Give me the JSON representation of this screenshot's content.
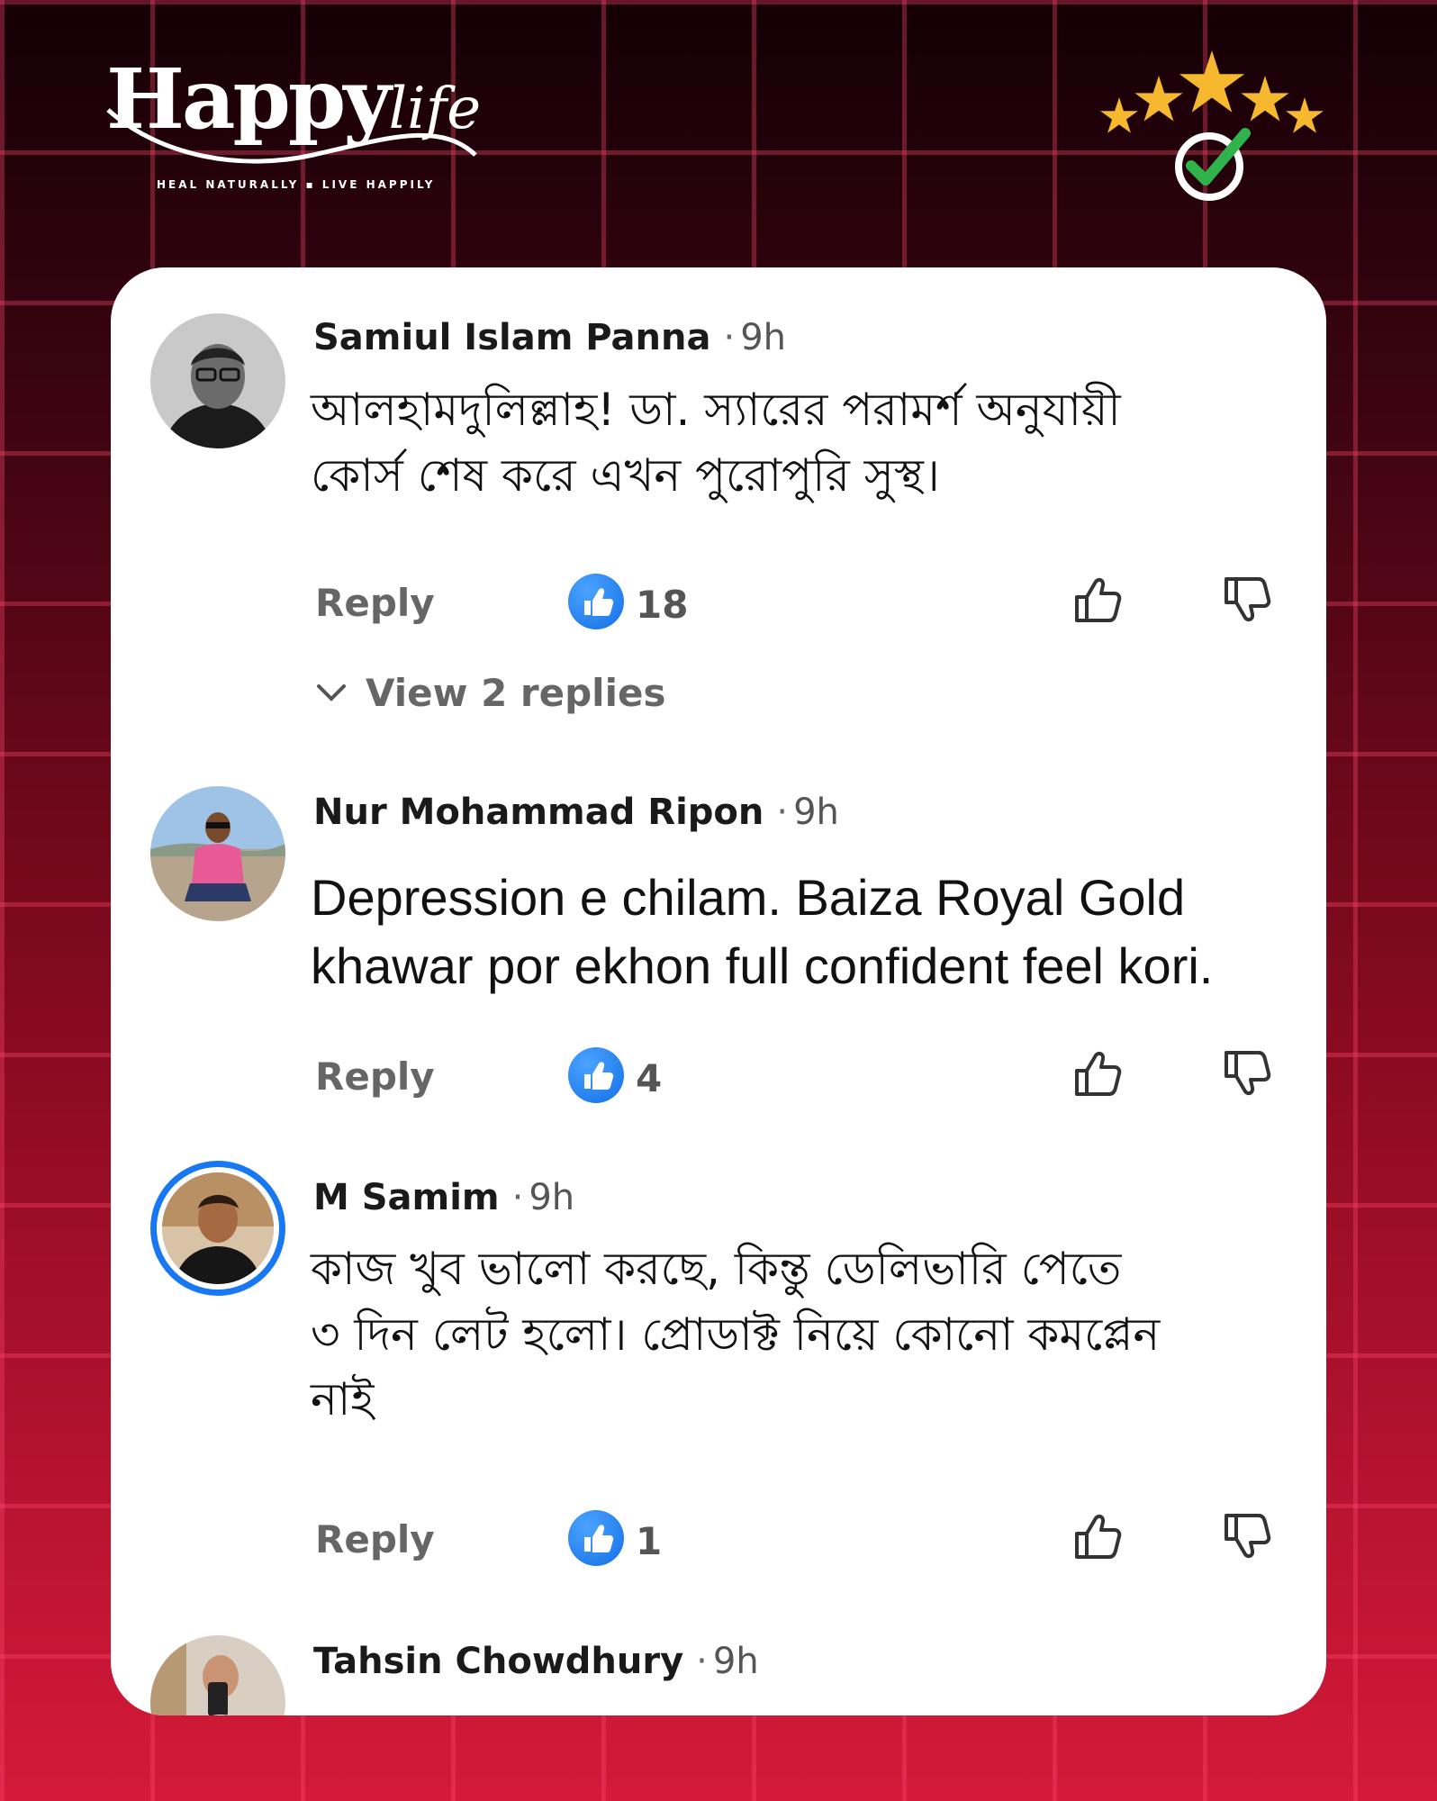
{
  "brand": {
    "logo_text_happy": "Happy",
    "logo_text_life": "life",
    "tagline": "HEAL NATURALLY ▪ LIVE HAPPILY",
    "badge_icon": "five-stars-check-icon"
  },
  "colors": {
    "like_blue": "#1877f2",
    "accent_red": "#d5193a",
    "check_green": "#2fb34a",
    "star_gold": "#f5b82e"
  },
  "comments": [
    {
      "name": "Samiul Islam Panna",
      "separator": "·",
      "time": "9h",
      "text_line1": "আলহামদুলিল্লাহ! ডা. স্যারের পরামর্শ অনুযায়ী",
      "text_line2": "কোর্স শেষ করে এখন পুরোপুরি সুস্থ।",
      "reply_label": "Reply",
      "likes": "18",
      "view_replies": "View 2 replies"
    },
    {
      "name": "Nur Mohammad Ripon",
      "separator": "·",
      "time": "9h",
      "text_line1": "Depression e chilam. Baiza Royal Gold",
      "text_line2": "khawar por ekhon full confident feel kori.",
      "reply_label": "Reply",
      "likes": "4"
    },
    {
      "name": "M Samim",
      "separator": "·",
      "time": "9h",
      "text_line1": "কাজ খুব ভালো করছে, কিন্তু ডেলিভারি পেতে",
      "text_line2": "৩ দিন লেট হলো। প্রোডাক্ট নিয়ে কোনো কমপ্লেন",
      "text_line3": "নাই",
      "reply_label": "Reply",
      "likes": "1"
    },
    {
      "name": "Tahsin Chowdhury",
      "separator": "·",
      "time": "9h"
    }
  ]
}
